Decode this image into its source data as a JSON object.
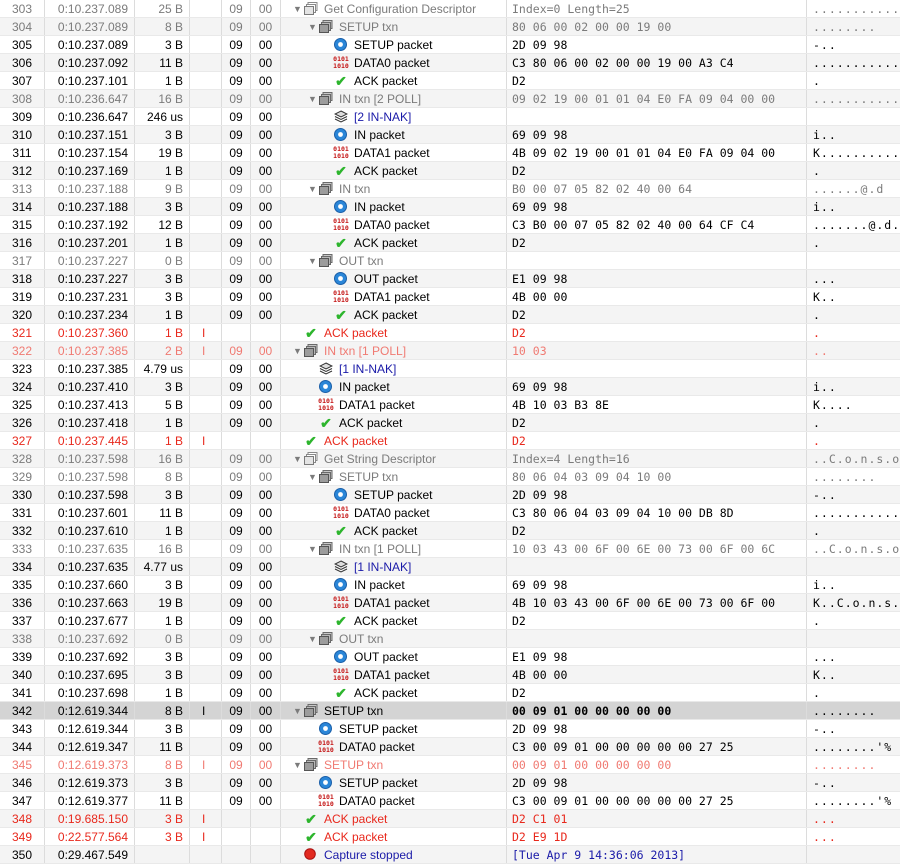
{
  "colors": {
    "error": "#e8281c",
    "nak": "#1a1aa8",
    "check": "#2db52d",
    "data_icon": "#c41414"
  },
  "rows": [
    {
      "idx": "303",
      "time": "0:10.237.089",
      "len": "25 B",
      "err": "",
      "dev": "09",
      "ep": "00",
      "indent": 0,
      "tri": "down",
      "icon": "request-icon",
      "label": "Get Configuration Descriptor",
      "data": "Index=0 Length=25",
      "ascii": "..............",
      "style": "grey"
    },
    {
      "idx": "304",
      "time": "0:10.237.089",
      "len": "8 B",
      "err": "",
      "dev": "09",
      "ep": "00",
      "indent": 1,
      "tri": "down",
      "icon": "transaction-icon",
      "label": "SETUP txn",
      "data": "80 06 00 02 00 00 19 00",
      "ascii": "........",
      "style": "grey"
    },
    {
      "idx": "305",
      "time": "0:10.237.089",
      "len": "3 B",
      "err": "",
      "dev": "09",
      "ep": "00",
      "indent": 2,
      "tri": "",
      "icon": "token-packet-icon",
      "label": "SETUP packet",
      "data": "2D 09 98",
      "ascii": "-..",
      "style": ""
    },
    {
      "idx": "306",
      "time": "0:10.237.092",
      "len": "11 B",
      "err": "",
      "dev": "09",
      "ep": "00",
      "indent": 2,
      "tri": "",
      "icon": "data-packet-icon",
      "label": "DATA0 packet",
      "data": "C3 80 06 00 02 00 00 19 00 A3 C4",
      "ascii": "...........",
      "style": ""
    },
    {
      "idx": "307",
      "time": "0:10.237.101",
      "len": "1 B",
      "err": "",
      "dev": "09",
      "ep": "00",
      "indent": 2,
      "tri": "",
      "icon": "ack-check-icon",
      "label": "ACK packet",
      "data": "D2",
      "ascii": ".",
      "style": ""
    },
    {
      "idx": "308",
      "time": "0:10.236.647",
      "len": "16 B",
      "err": "",
      "dev": "09",
      "ep": "00",
      "indent": 1,
      "tri": "down",
      "icon": "transaction-icon",
      "label": "IN txn  [2 POLL]",
      "data": "09 02 19 00 01 01 04 E0 FA 09 04 00 00",
      "ascii": "..............",
      "style": "grey"
    },
    {
      "idx": "309",
      "time": "0:10.236.647",
      "len": "246 us",
      "err": "",
      "dev": "09",
      "ep": "00",
      "indent": 2,
      "tri": "",
      "icon": "nak-stack-icon",
      "label": "[2 IN-NAK]",
      "data": "",
      "ascii": "",
      "style": "blue"
    },
    {
      "idx": "310",
      "time": "0:10.237.151",
      "len": "3 B",
      "err": "",
      "dev": "09",
      "ep": "00",
      "indent": 2,
      "tri": "",
      "icon": "token-packet-icon",
      "label": "IN packet",
      "data": "69 09 98",
      "ascii": "i..",
      "style": ""
    },
    {
      "idx": "311",
      "time": "0:10.237.154",
      "len": "19 B",
      "err": "",
      "dev": "09",
      "ep": "00",
      "indent": 2,
      "tri": "",
      "icon": "data-packet-icon",
      "label": "DATA1 packet",
      "data": "4B 09 02 19 00 01 01 04 E0 FA 09 04 00",
      "ascii": "K............",
      "style": ""
    },
    {
      "idx": "312",
      "time": "0:10.237.169",
      "len": "1 B",
      "err": "",
      "dev": "09",
      "ep": "00",
      "indent": 2,
      "tri": "",
      "icon": "ack-check-icon",
      "label": "ACK packet",
      "data": "D2",
      "ascii": ".",
      "style": ""
    },
    {
      "idx": "313",
      "time": "0:10.237.188",
      "len": "9 B",
      "err": "",
      "dev": "09",
      "ep": "00",
      "indent": 1,
      "tri": "down",
      "icon": "transaction-icon",
      "label": "IN txn",
      "data": "B0 00 07 05 82 02 40 00 64",
      "ascii": "......@.d",
      "style": "grey"
    },
    {
      "idx": "314",
      "time": "0:10.237.188",
      "len": "3 B",
      "err": "",
      "dev": "09",
      "ep": "00",
      "indent": 2,
      "tri": "",
      "icon": "token-packet-icon",
      "label": "IN packet",
      "data": "69 09 98",
      "ascii": "i..",
      "style": ""
    },
    {
      "idx": "315",
      "time": "0:10.237.192",
      "len": "12 B",
      "err": "",
      "dev": "09",
      "ep": "00",
      "indent": 2,
      "tri": "",
      "icon": "data-packet-icon",
      "label": "DATA0 packet",
      "data": "C3 B0 00 07 05 82 02 40 00 64 CF C4",
      "ascii": ".......@.d..",
      "style": ""
    },
    {
      "idx": "316",
      "time": "0:10.237.201",
      "len": "1 B",
      "err": "",
      "dev": "09",
      "ep": "00",
      "indent": 2,
      "tri": "",
      "icon": "ack-check-icon",
      "label": "ACK packet",
      "data": "D2",
      "ascii": ".",
      "style": ""
    },
    {
      "idx": "317",
      "time": "0:10.237.227",
      "len": "0 B",
      "err": "",
      "dev": "09",
      "ep": "00",
      "indent": 1,
      "tri": "down",
      "icon": "transaction-icon",
      "label": "OUT txn",
      "data": "",
      "ascii": "",
      "style": "grey"
    },
    {
      "idx": "318",
      "time": "0:10.237.227",
      "len": "3 B",
      "err": "",
      "dev": "09",
      "ep": "00",
      "indent": 2,
      "tri": "",
      "icon": "token-packet-icon",
      "label": "OUT packet",
      "data": "E1 09 98",
      "ascii": "...",
      "style": ""
    },
    {
      "idx": "319",
      "time": "0:10.237.231",
      "len": "3 B",
      "err": "",
      "dev": "09",
      "ep": "00",
      "indent": 2,
      "tri": "",
      "icon": "data-packet-icon",
      "label": "DATA1 packet",
      "data": "4B 00 00",
      "ascii": "K..",
      "style": ""
    },
    {
      "idx": "320",
      "time": "0:10.237.234",
      "len": "1 B",
      "err": "",
      "dev": "09",
      "ep": "00",
      "indent": 2,
      "tri": "",
      "icon": "ack-check-icon",
      "label": "ACK packet",
      "data": "D2",
      "ascii": ".",
      "style": ""
    },
    {
      "idx": "321",
      "time": "0:10.237.360",
      "len": "1 B",
      "err": "I",
      "dev": "",
      "ep": "",
      "indent": 0,
      "tri": "",
      "icon": "ack-check-icon",
      "label": "ACK packet",
      "data": "D2",
      "ascii": ".",
      "style": "red"
    },
    {
      "idx": "322",
      "time": "0:10.237.385",
      "len": "2 B",
      "err": "I",
      "dev": "09",
      "ep": "00",
      "indent": 0,
      "tri": "down",
      "icon": "transaction-icon",
      "label": "IN txn   [1 POLL]",
      "data": "10 03",
      "ascii": "..",
      "style": "pink"
    },
    {
      "idx": "323",
      "time": "0:10.237.385",
      "len": "4.79 us",
      "err": "",
      "dev": "09",
      "ep": "00",
      "indent": 1,
      "tri": "",
      "icon": "nak-stack-icon",
      "label": "[1 IN-NAK]",
      "data": "",
      "ascii": "",
      "style": "blue"
    },
    {
      "idx": "324",
      "time": "0:10.237.410",
      "len": "3 B",
      "err": "",
      "dev": "09",
      "ep": "00",
      "indent": 1,
      "tri": "",
      "icon": "token-packet-icon",
      "label": "IN packet",
      "data": "69 09 98",
      "ascii": "i..",
      "style": ""
    },
    {
      "idx": "325",
      "time": "0:10.237.413",
      "len": "5 B",
      "err": "",
      "dev": "09",
      "ep": "00",
      "indent": 1,
      "tri": "",
      "icon": "data-packet-icon",
      "label": "DATA1 packet",
      "data": "4B 10 03 B3 8E",
      "ascii": "K....",
      "style": ""
    },
    {
      "idx": "326",
      "time": "0:10.237.418",
      "len": "1 B",
      "err": "",
      "dev": "09",
      "ep": "00",
      "indent": 1,
      "tri": "",
      "icon": "ack-check-icon",
      "label": "ACK packet",
      "data": "D2",
      "ascii": ".",
      "style": ""
    },
    {
      "idx": "327",
      "time": "0:10.237.445",
      "len": "1 B",
      "err": "I",
      "dev": "",
      "ep": "",
      "indent": 0,
      "tri": "",
      "icon": "ack-check-icon",
      "label": "ACK packet",
      "data": "D2",
      "ascii": ".",
      "style": "red"
    },
    {
      "idx": "328",
      "time": "0:10.237.598",
      "len": "16 B",
      "err": "",
      "dev": "09",
      "ep": "00",
      "indent": 0,
      "tri": "down",
      "icon": "request-icon",
      "label": "Get String Descriptor",
      "data": "Index=4 Length=16",
      "ascii": "..C.o.n.s.o.l",
      "style": "grey"
    },
    {
      "idx": "329",
      "time": "0:10.237.598",
      "len": "8 B",
      "err": "",
      "dev": "09",
      "ep": "00",
      "indent": 1,
      "tri": "down",
      "icon": "transaction-icon",
      "label": "SETUP txn",
      "data": "80 06 04 03 09 04 10 00",
      "ascii": "........",
      "style": "grey"
    },
    {
      "idx": "330",
      "time": "0:10.237.598",
      "len": "3 B",
      "err": "",
      "dev": "09",
      "ep": "00",
      "indent": 2,
      "tri": "",
      "icon": "token-packet-icon",
      "label": "SETUP packet",
      "data": "2D 09 98",
      "ascii": "-..",
      "style": ""
    },
    {
      "idx": "331",
      "time": "0:10.237.601",
      "len": "11 B",
      "err": "",
      "dev": "09",
      "ep": "00",
      "indent": 2,
      "tri": "",
      "icon": "data-packet-icon",
      "label": "DATA0 packet",
      "data": "C3 80 06 04 03 09 04 10 00 DB 8D",
      "ascii": "...........",
      "style": ""
    },
    {
      "idx": "332",
      "time": "0:10.237.610",
      "len": "1 B",
      "err": "",
      "dev": "09",
      "ep": "00",
      "indent": 2,
      "tri": "",
      "icon": "ack-check-icon",
      "label": "ACK packet",
      "data": "D2",
      "ascii": ".",
      "style": ""
    },
    {
      "idx": "333",
      "time": "0:10.237.635",
      "len": "16 B",
      "err": "",
      "dev": "09",
      "ep": "00",
      "indent": 1,
      "tri": "down",
      "icon": "transaction-icon",
      "label": "IN txn   [1 POLL]",
      "data": "10 03 43 00 6F 00 6E 00 73 00 6F 00 6C",
      "ascii": "..C.o.n.s.o.l",
      "style": "grey"
    },
    {
      "idx": "334",
      "time": "0:10.237.635",
      "len": "4.77 us",
      "err": "",
      "dev": "09",
      "ep": "00",
      "indent": 2,
      "tri": "",
      "icon": "nak-stack-icon",
      "label": "[1 IN-NAK]",
      "data": "",
      "ascii": "",
      "style": "blue"
    },
    {
      "idx": "335",
      "time": "0:10.237.660",
      "len": "3 B",
      "err": "",
      "dev": "09",
      "ep": "00",
      "indent": 2,
      "tri": "",
      "icon": "token-packet-icon",
      "label": "IN packet",
      "data": "69 09 98",
      "ascii": "i..",
      "style": ""
    },
    {
      "idx": "336",
      "time": "0:10.237.663",
      "len": "19 B",
      "err": "",
      "dev": "09",
      "ep": "00",
      "indent": 2,
      "tri": "",
      "icon": "data-packet-icon",
      "label": "DATA1 packet",
      "data": "4B 10 03 43 00 6F 00 6E 00 73 00 6F 00",
      "ascii": "K..C.o.n.s.o.",
      "style": ""
    },
    {
      "idx": "337",
      "time": "0:10.237.677",
      "len": "1 B",
      "err": "",
      "dev": "09",
      "ep": "00",
      "indent": 2,
      "tri": "",
      "icon": "ack-check-icon",
      "label": "ACK packet",
      "data": "D2",
      "ascii": ".",
      "style": ""
    },
    {
      "idx": "338",
      "time": "0:10.237.692",
      "len": "0 B",
      "err": "",
      "dev": "09",
      "ep": "00",
      "indent": 1,
      "tri": "down",
      "icon": "transaction-icon",
      "label": "OUT txn",
      "data": "",
      "ascii": "",
      "style": "grey"
    },
    {
      "idx": "339",
      "time": "0:10.237.692",
      "len": "3 B",
      "err": "",
      "dev": "09",
      "ep": "00",
      "indent": 2,
      "tri": "",
      "icon": "token-packet-icon",
      "label": "OUT packet",
      "data": "E1 09 98",
      "ascii": "...",
      "style": ""
    },
    {
      "idx": "340",
      "time": "0:10.237.695",
      "len": "3 B",
      "err": "",
      "dev": "09",
      "ep": "00",
      "indent": 2,
      "tri": "",
      "icon": "data-packet-icon",
      "label": "DATA1 packet",
      "data": "4B 00 00",
      "ascii": "K..",
      "style": ""
    },
    {
      "idx": "341",
      "time": "0:10.237.698",
      "len": "1 B",
      "err": "",
      "dev": "09",
      "ep": "00",
      "indent": 2,
      "tri": "",
      "icon": "ack-check-icon",
      "label": "ACK packet",
      "data": "D2",
      "ascii": ".",
      "style": ""
    },
    {
      "idx": "342",
      "time": "0:12.619.344",
      "len": "8 B",
      "err": "I",
      "dev": "09",
      "ep": "00",
      "indent": 0,
      "tri": "down",
      "icon": "transaction-icon",
      "label": "SETUP txn",
      "data": "00 09 01 00 00 00 00 00",
      "ascii": "........",
      "style": "sel bold"
    },
    {
      "idx": "343",
      "time": "0:12.619.344",
      "len": "3 B",
      "err": "",
      "dev": "09",
      "ep": "00",
      "indent": 1,
      "tri": "",
      "icon": "token-packet-icon",
      "label": "SETUP packet",
      "data": "2D 09 98",
      "ascii": "-..",
      "style": ""
    },
    {
      "idx": "344",
      "time": "0:12.619.347",
      "len": "11 B",
      "err": "",
      "dev": "09",
      "ep": "00",
      "indent": 1,
      "tri": "",
      "icon": "data-packet-icon",
      "label": "DATA0 packet",
      "data": "C3 00 09 01 00 00 00 00 00 27 25",
      "ascii": "........'%",
      "style": ""
    },
    {
      "idx": "345",
      "time": "0:12.619.373",
      "len": "8 B",
      "err": "I",
      "dev": "09",
      "ep": "00",
      "indent": 0,
      "tri": "down",
      "icon": "transaction-icon",
      "label": "SETUP txn",
      "data": "00 09 01 00 00 00 00 00",
      "ascii": "........",
      "style": "pink"
    },
    {
      "idx": "346",
      "time": "0:12.619.373",
      "len": "3 B",
      "err": "",
      "dev": "09",
      "ep": "00",
      "indent": 1,
      "tri": "",
      "icon": "token-packet-icon",
      "label": "SETUP packet",
      "data": "2D 09 98",
      "ascii": "-..",
      "style": ""
    },
    {
      "idx": "347",
      "time": "0:12.619.377",
      "len": "11 B",
      "err": "",
      "dev": "09",
      "ep": "00",
      "indent": 1,
      "tri": "",
      "icon": "data-packet-icon",
      "label": "DATA0 packet",
      "data": "C3 00 09 01 00 00 00 00 00 27 25",
      "ascii": "........'%",
      "style": ""
    },
    {
      "idx": "348",
      "time": "0:19.685.150",
      "len": "3 B",
      "err": "I",
      "dev": "",
      "ep": "",
      "indent": 0,
      "tri": "",
      "icon": "ack-check-icon",
      "label": "ACK packet",
      "data": "D2 C1 01",
      "ascii": "...",
      "style": "red"
    },
    {
      "idx": "349",
      "time": "0:22.577.564",
      "len": "3 B",
      "err": "I",
      "dev": "",
      "ep": "",
      "indent": 0,
      "tri": "",
      "icon": "ack-check-icon",
      "label": "ACK packet",
      "data": "D2 E9 1D",
      "ascii": "...",
      "style": "red"
    },
    {
      "idx": "350",
      "time": "0:29.467.549",
      "len": "",
      "err": "",
      "dev": "",
      "ep": "",
      "indent": 0,
      "tri": "",
      "icon": "capture-stopped-icon",
      "label": "Capture stopped",
      "data": "[Tue Apr  9 14:36:06 2013]",
      "ascii": "",
      "style": "blue"
    }
  ]
}
